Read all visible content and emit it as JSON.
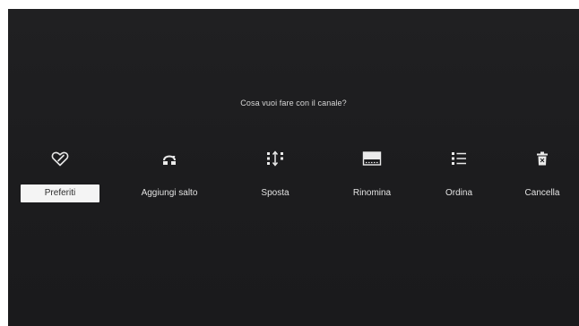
{
  "dialog": {
    "prompt": "Cosa vuoi fare con il canale?"
  },
  "actions": [
    {
      "label": "Preferiti",
      "icon": "favorite-tag-icon",
      "selected": true
    },
    {
      "label": "Aggiungi salto",
      "icon": "add-skip-icon",
      "selected": false
    },
    {
      "label": "Sposta",
      "icon": "move-icon",
      "selected": false
    },
    {
      "label": "Rinomina",
      "icon": "rename-icon",
      "selected": false
    },
    {
      "label": "Ordina",
      "icon": "sort-list-icon",
      "selected": false
    },
    {
      "label": "Cancella",
      "icon": "trash-icon",
      "selected": false
    }
  ],
  "colors": {
    "background": "#1c1c1e",
    "text": "#e2e2e2",
    "selected_bg": "#f4f4f4",
    "selected_text": "#2c2c2c"
  }
}
